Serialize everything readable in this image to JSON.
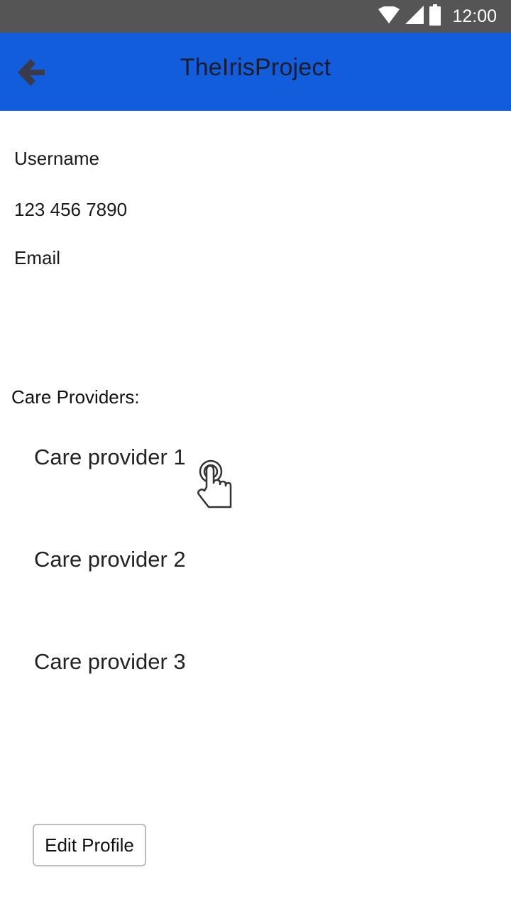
{
  "status_bar": {
    "time": "12:00",
    "icons": [
      "wifi-icon",
      "signal-icon",
      "battery-icon"
    ],
    "background": "#555555"
  },
  "app_bar": {
    "title": "TheIrisProject",
    "back_icon": "back-arrow-icon",
    "background": "#115ddc"
  },
  "profile": {
    "username": "Username",
    "phone": "123 456 7890",
    "email": "Email"
  },
  "care_providers": {
    "label": "Care Providers:",
    "items": [
      "Care provider 1",
      "Care provider 2",
      "Care provider 3"
    ]
  },
  "cursor_icon": "pointer-hand-icon",
  "edit_button": {
    "label": "Edit Profile"
  }
}
